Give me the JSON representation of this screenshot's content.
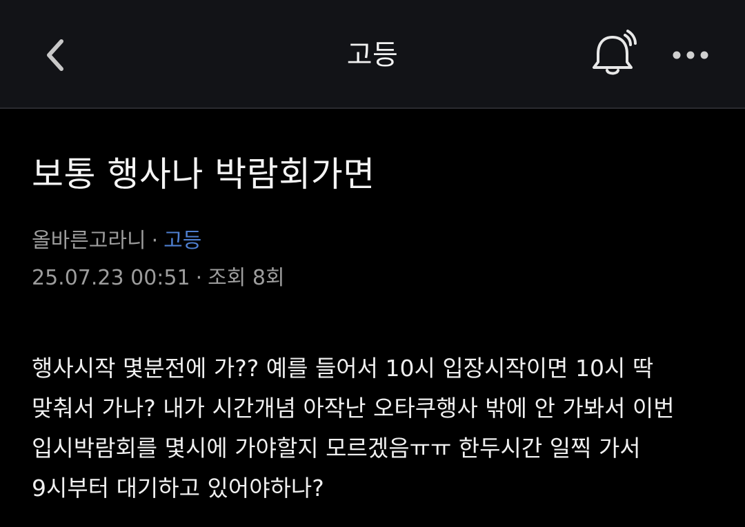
{
  "header": {
    "title": "고등",
    "back_icon": "chevron-left-icon",
    "bell_icon": "bell-ringing-icon",
    "more_icon": "more-horizontal-icon"
  },
  "post": {
    "title": "보통 행사나 박람회가면",
    "author": "올바른고라니",
    "separator": "·",
    "board": "고등",
    "datetime": "25.07.23 00:51",
    "views": "조회 8회",
    "body": "행사시작 몇분전에 가?? 예를 들어서 10시 입장시작이면 10시 딱 맞춰서 가나? 내가 시간개념 아작난 오타쿠행사 밖에 안 가봐서 이번 입시박람회를 몇시에 가야할지 모르겠음ㅠㅠ  한두시간 일찍 가서 9시부터 대기하고 있어야하나?"
  },
  "colors": {
    "background": "#000000",
    "header_bg": "#121317",
    "text_primary": "#f0f0f0",
    "text_meta": "#9d9d9d",
    "link": "#4e7fd0"
  }
}
